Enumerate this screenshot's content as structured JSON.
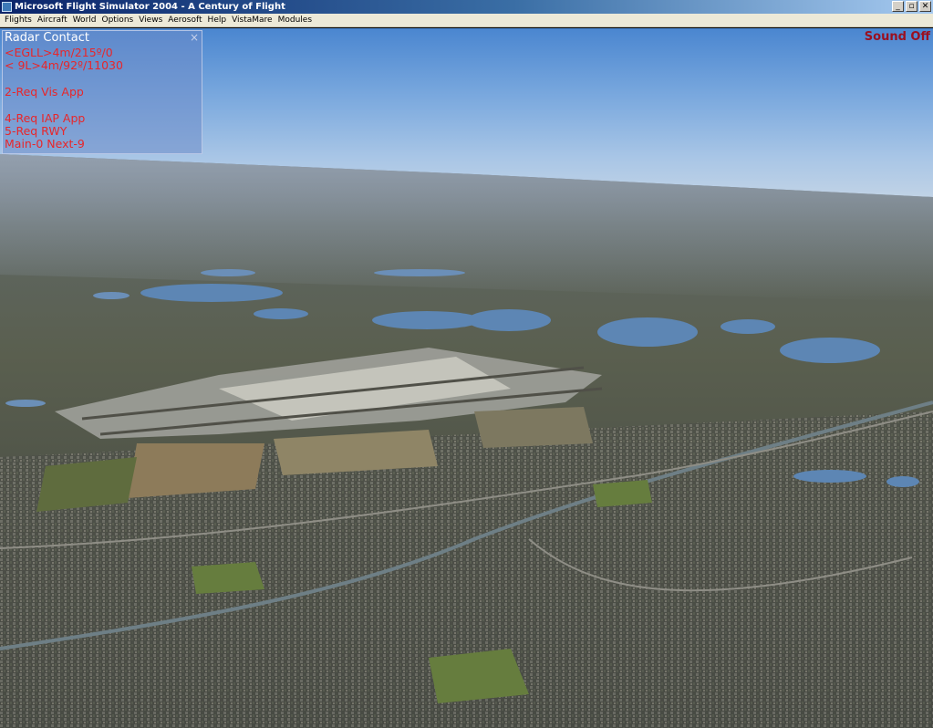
{
  "window": {
    "title": "Microsoft Flight Simulator 2004 - A Century of Flight"
  },
  "window_buttons": {
    "minimize": "_",
    "maximize": "▫",
    "close": "✕"
  },
  "menu": [
    "Flights",
    "Aircraft",
    "World",
    "Options",
    "Views",
    "Aerosoft",
    "Help",
    "VistaMare",
    "Modules"
  ],
  "radar_contact": {
    "title": "Radar Contact",
    "close_glyph": "×",
    "lines": [
      "<EGLL>4m/215º/0",
      "< 9L>4m/92º/11030",
      "",
      "2-Req Vis App",
      "",
      "4-Req IAP App",
      "5-Req RWY",
      "Main-0 Next-9"
    ]
  },
  "status": {
    "sound": "Sound Off"
  },
  "colors": {
    "radar_text": "#e8262a",
    "sound_text": "#9a1020",
    "title_bar": "#0a246a"
  }
}
